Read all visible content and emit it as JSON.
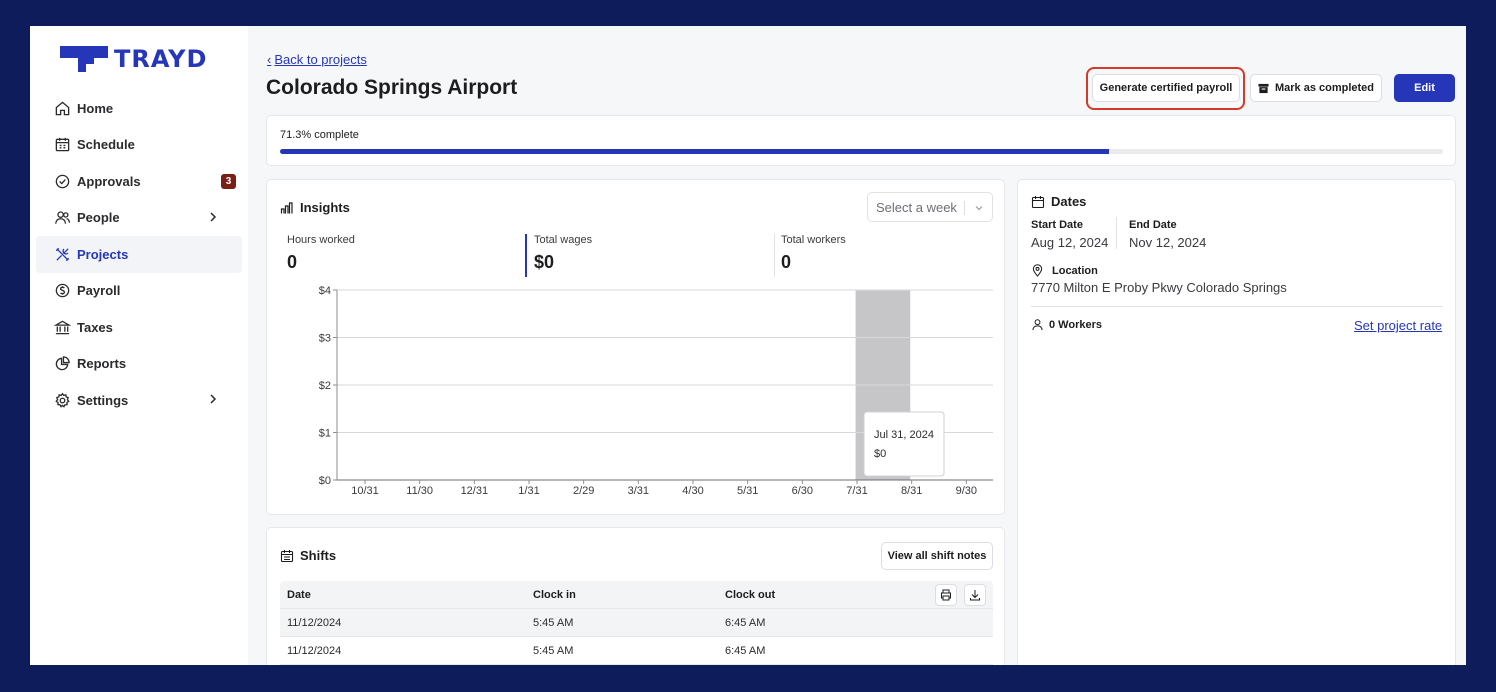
{
  "brand": {
    "name": "TRAYD",
    "color": "#2537b8"
  },
  "sidebar": {
    "items": [
      {
        "label": "Home",
        "icon": "home-icon"
      },
      {
        "label": "Schedule",
        "icon": "calendar-icon"
      },
      {
        "label": "Approvals",
        "icon": "check-circle-icon",
        "badge": "3"
      },
      {
        "label": "People",
        "icon": "people-icon"
      },
      {
        "label": "Projects",
        "icon": "tools-icon"
      },
      {
        "label": "Payroll",
        "icon": "dollar-circle-icon"
      },
      {
        "label": "Taxes",
        "icon": "bank-icon"
      },
      {
        "label": "Reports",
        "icon": "pie-chart-icon"
      },
      {
        "label": "Settings",
        "icon": "gear-icon"
      }
    ]
  },
  "header": {
    "back_label": "Back to projects",
    "title": "Colorado Springs Airport",
    "generate_label": "Generate certified payroll",
    "mark_label": "Mark as completed",
    "edit_label": "Edit"
  },
  "progress": {
    "label": "71.3% complete",
    "fraction": 0.713
  },
  "insights": {
    "title": "Insights",
    "select_placeholder": "Select a week",
    "stats": [
      {
        "label": "Hours worked",
        "value": "0"
      },
      {
        "label": "Total wages",
        "value": "$0"
      },
      {
        "label": "Total workers",
        "value": "0"
      }
    ]
  },
  "chart_data": {
    "type": "bar",
    "categories": [
      "10/31",
      "11/30",
      "12/31",
      "1/31",
      "2/29",
      "3/31",
      "4/30",
      "5/31",
      "6/30",
      "7/31",
      "8/31",
      "9/30"
    ],
    "values": [
      0,
      0,
      0,
      0,
      0,
      0,
      0,
      0,
      0,
      0,
      0,
      0
    ],
    "highlight_index": 9,
    "ylim": [
      0,
      4
    ],
    "yticks": [
      "$0",
      "$1",
      "$2",
      "$3",
      "$4"
    ],
    "grid": true,
    "tooltip": {
      "title": "Jul 31, 2024",
      "value": "$0"
    }
  },
  "dates": {
    "title": "Dates",
    "start_label": "Start Date",
    "start_value": "Aug 12, 2024",
    "end_label": "End Date",
    "end_value": "Nov 12, 2024",
    "location_label": "Location",
    "location_value": "7770 Milton E Proby Pkwy Colorado Springs",
    "workers_label": "0 Workers",
    "rate_link": "Set project rate"
  },
  "shifts": {
    "title": "Shifts",
    "notes_label": "View all shift notes",
    "columns": [
      "Date",
      "Clock in",
      "Clock out"
    ],
    "rows": [
      [
        "11/12/2024",
        "5:45 AM",
        "6:45 AM"
      ],
      [
        "11/12/2024",
        "5:45 AM",
        "6:45 AM"
      ]
    ]
  }
}
